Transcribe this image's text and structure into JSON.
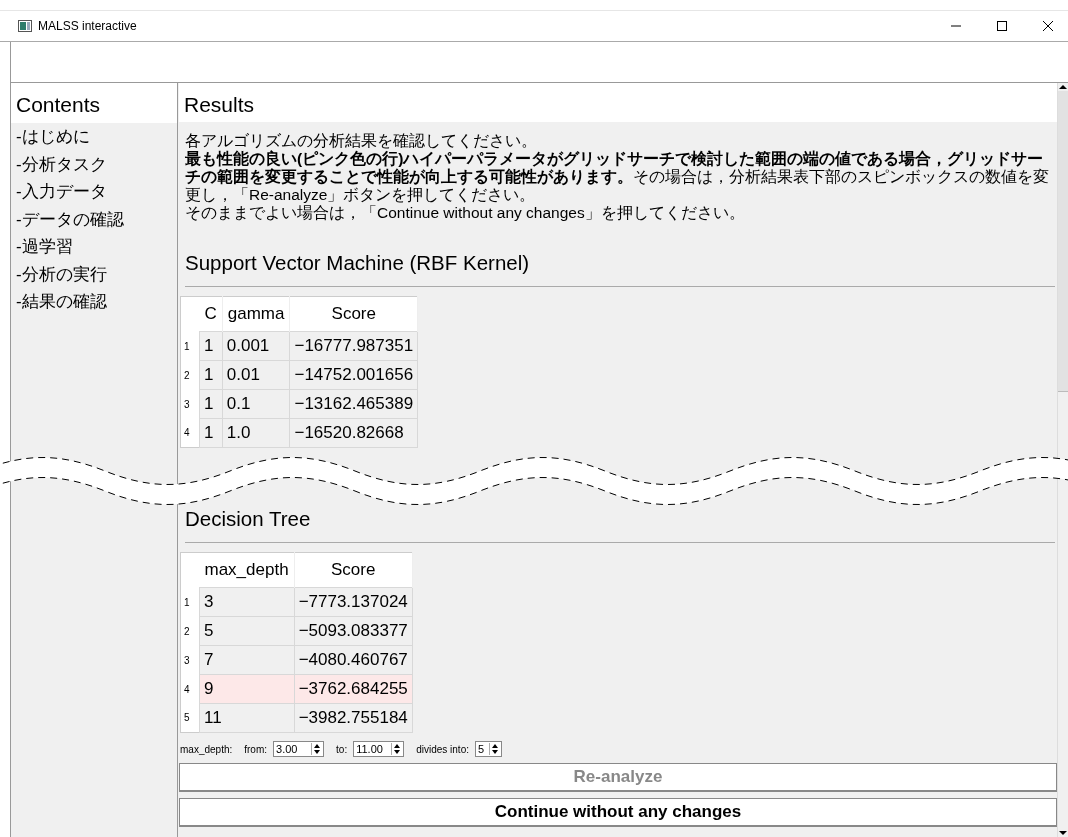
{
  "window": {
    "title": "MALSS interactive"
  },
  "sidebar": {
    "title": "Contents",
    "items": [
      "-はじめに",
      "-分析タスク",
      "-入力データ",
      "-データの確認",
      "-過学習",
      "-分析の実行",
      "-結果の確認"
    ]
  },
  "main": {
    "title": "Results",
    "description": [
      "各アルゴリズムの分析結果を確認してください。",
      "**最も性能の良い(ピンク色の行)ハイパーパラメータがグリッドサーチで検討した範囲の端の値である場合，グリッドサーチの範囲を変更することで性能が向上する可能性があります。**その場合は，分析結果表下部のスピンボックスの数値を変更し，「Re-analyze」ボタンを押してください。",
      "そのままでよい場合は，「Continue without any changes」を押してください。"
    ]
  },
  "sections": [
    {
      "title": "Support Vector Machine (RBF Kernel)",
      "table": {
        "columns": [
          "C",
          "gamma",
          "Score"
        ],
        "rows": [
          {
            "index": "1",
            "cells": [
              "1",
              "0.001",
              "−16777.987351"
            ],
            "highlighted": false
          },
          {
            "index": "2",
            "cells": [
              "1",
              "0.01",
              "−14752.001656"
            ],
            "highlighted": false
          },
          {
            "index": "3",
            "cells": [
              "1",
              "0.1",
              "−13162.465389"
            ],
            "highlighted": false
          },
          {
            "index": "4",
            "cells": [
              "1",
              "1.0",
              "−16520.82668"
            ],
            "highlighted": false
          }
        ]
      }
    },
    {
      "title": "Decision Tree",
      "table": {
        "columns": [
          "max_depth",
          "Score"
        ],
        "rows": [
          {
            "index": "1",
            "cells": [
              "3",
              "−7773.137024"
            ],
            "highlighted": false
          },
          {
            "index": "2",
            "cells": [
              "5",
              "−5093.083377"
            ],
            "highlighted": false
          },
          {
            "index": "3",
            "cells": [
              "7",
              "−4080.460767"
            ],
            "highlighted": false
          },
          {
            "index": "4",
            "cells": [
              "9",
              "−3762.684255"
            ],
            "highlighted": true
          },
          {
            "index": "5",
            "cells": [
              "11",
              "−3982.755184"
            ],
            "highlighted": false
          }
        ]
      },
      "controls": {
        "parameter": "max_depth:",
        "from_label": "from:",
        "from": "3.00",
        "to_label": "to:",
        "to": "11.00",
        "divides_label": "divides into:",
        "divides": "5"
      }
    }
  ],
  "buttons": [
    {
      "label": "Re-analyze",
      "disabled": true
    },
    {
      "label": "Continue without any changes",
      "disabled": false
    }
  ]
}
